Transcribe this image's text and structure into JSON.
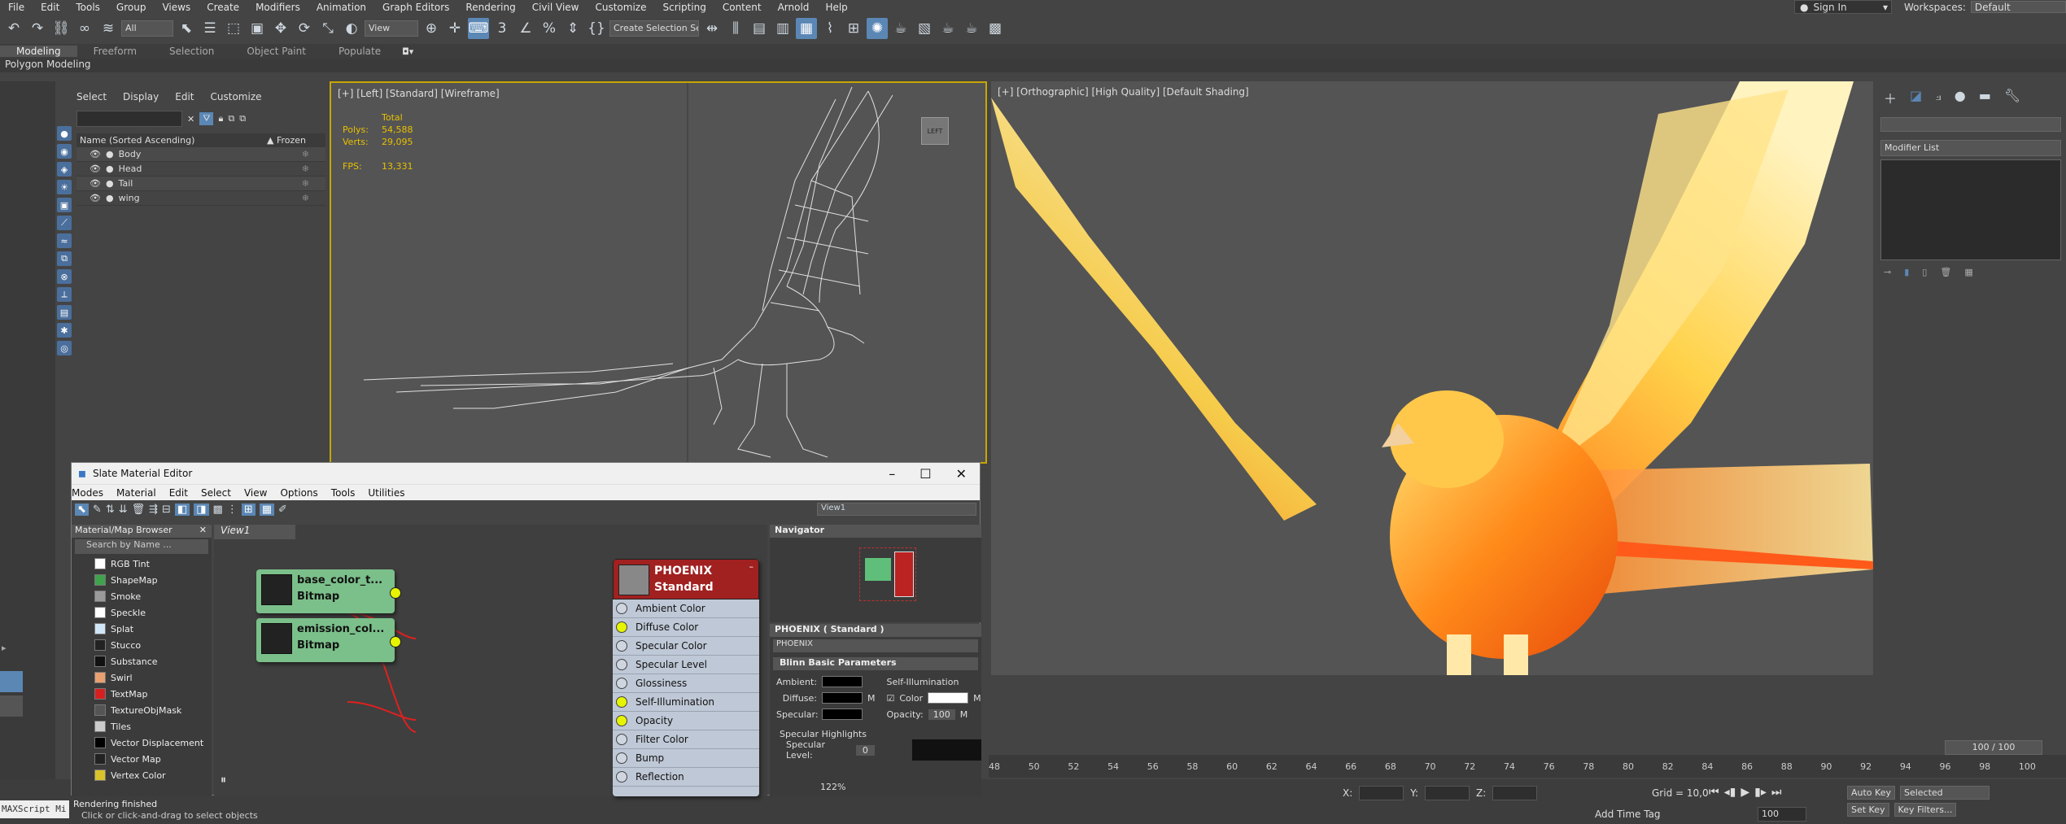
{
  "menu": [
    "File",
    "Edit",
    "Tools",
    "Group",
    "Views",
    "Create",
    "Modifiers",
    "Animation",
    "Graph Editors",
    "Rendering",
    "Civil View",
    "Customize",
    "Scripting",
    "Content",
    "Arnold",
    "Help"
  ],
  "account": {
    "signin": "Sign In",
    "workspaces_label": "Workspaces:",
    "workspace": "Default"
  },
  "toolbar": {
    "filter": "All",
    "coord_system": "View",
    "selection_set": "Create Selection Se"
  },
  "ribbon": {
    "tabs": [
      "Modeling",
      "Freeform",
      "Selection",
      "Object Paint",
      "Populate"
    ],
    "panel": "Polygon Modeling"
  },
  "scene_explorer": {
    "menu": [
      "Select",
      "Display",
      "Edit",
      "Customize"
    ],
    "col_name": "Name (Sorted Ascending)",
    "col_frozen": "▲ Frozen",
    "items": [
      "Body",
      "Head",
      "Tail",
      "wing"
    ]
  },
  "viewport_left": {
    "label": "[+] [Left] [Standard] [Wireframe]",
    "stats": {
      "total": "Total",
      "polys_label": "Polys:",
      "polys": "54,588",
      "verts_label": "Verts:",
      "verts": "29,095",
      "fps_label": "FPS:",
      "fps": "13,331"
    }
  },
  "viewport_right": {
    "label": "[+] [Orthographic] [High Quality] [Default Shading]"
  },
  "cmd_panel": {
    "modifier_list": "Modifier List"
  },
  "timeline": {
    "frames": "100 / 100",
    "ticks": [
      "48",
      "50",
      "52",
      "54",
      "56",
      "58",
      "60",
      "62",
      "64",
      "66",
      "68",
      "70",
      "72",
      "74",
      "76",
      "78",
      "80",
      "82",
      "84",
      "86",
      "88",
      "90",
      "92",
      "94",
      "96",
      "98",
      "100"
    ]
  },
  "status": {
    "maxscript": "MAXScript Mi",
    "render": "Rendering finished",
    "hint": "Click or click-and-drag to select objects",
    "x": "X:",
    "y": "Y:",
    "z": "Z:",
    "grid": "Grid = 10,0",
    "add_time_tag": "Add Time Tag",
    "frame": "100",
    "auto_key": "Auto Key",
    "selected": "Selected",
    "set_key": "Set Key",
    "key_filters": "Key Filters..."
  },
  "sme": {
    "title": "Slate Material Editor",
    "menu": [
      "Modes",
      "Material",
      "Edit",
      "Select",
      "View",
      "Options",
      "Tools",
      "Utilities"
    ],
    "view_dd": "View1",
    "browser": {
      "title": "Material/Map Browser",
      "search": "Search by Name ...",
      "items": [
        {
          "name": "RGB Tint",
          "color": "#ffffff"
        },
        {
          "name": "ShapeMap",
          "color": "#3fa34d"
        },
        {
          "name": "Smoke",
          "color": "#9a9a9a"
        },
        {
          "name": "Speckle",
          "color": "#ffffff"
        },
        {
          "name": "Splat",
          "color": "#d0e6f7"
        },
        {
          "name": "Stucco",
          "color": "#222222"
        },
        {
          "name": "Substance",
          "color": "#111111"
        },
        {
          "name": "Swirl",
          "color": "#e8a070"
        },
        {
          "name": "TextMap",
          "color": "#d62020"
        },
        {
          "name": "TextureObjMask",
          "color": "#555555"
        },
        {
          "name": "Tiles",
          "color": "#cccccc"
        },
        {
          "name": "Vector Displacement",
          "color": "#000000"
        },
        {
          "name": "Vector Map",
          "color": "#222222"
        },
        {
          "name": "Vertex Color",
          "color": "#d9c32b"
        }
      ]
    },
    "view_tab": "View1",
    "nodes": [
      {
        "name": "base_color_t...",
        "type": "Bitmap"
      },
      {
        "name": "emission_col...",
        "type": "Bitmap"
      }
    ],
    "material": {
      "name": "PHOENIX",
      "type": "Standard",
      "slots": [
        "Ambient Color",
        "Diffuse Color",
        "Specular Color",
        "Specular Level",
        "Glossiness",
        "Self-Illumination",
        "Opacity",
        "Filter Color",
        "Bump",
        "Reflection"
      ],
      "connected": [
        1,
        5,
        6
      ]
    },
    "navigator": "Navigator",
    "props_title": "PHOENIX  ( Standard )",
    "props_name": "PHOENIX",
    "rollout": "Blinn Basic Parameters",
    "ambient": "Ambient:",
    "diffuse": "Diffuse:",
    "specular": "Specular:",
    "self_illum": "Self-Illumination",
    "color_label": "Color",
    "opacity_label": "Opacity:",
    "opacity": "100",
    "spec_highlights": "Specular Highlights",
    "spec_level": "Specular Level:",
    "spec_level_val": "0",
    "zoom": "122%"
  }
}
